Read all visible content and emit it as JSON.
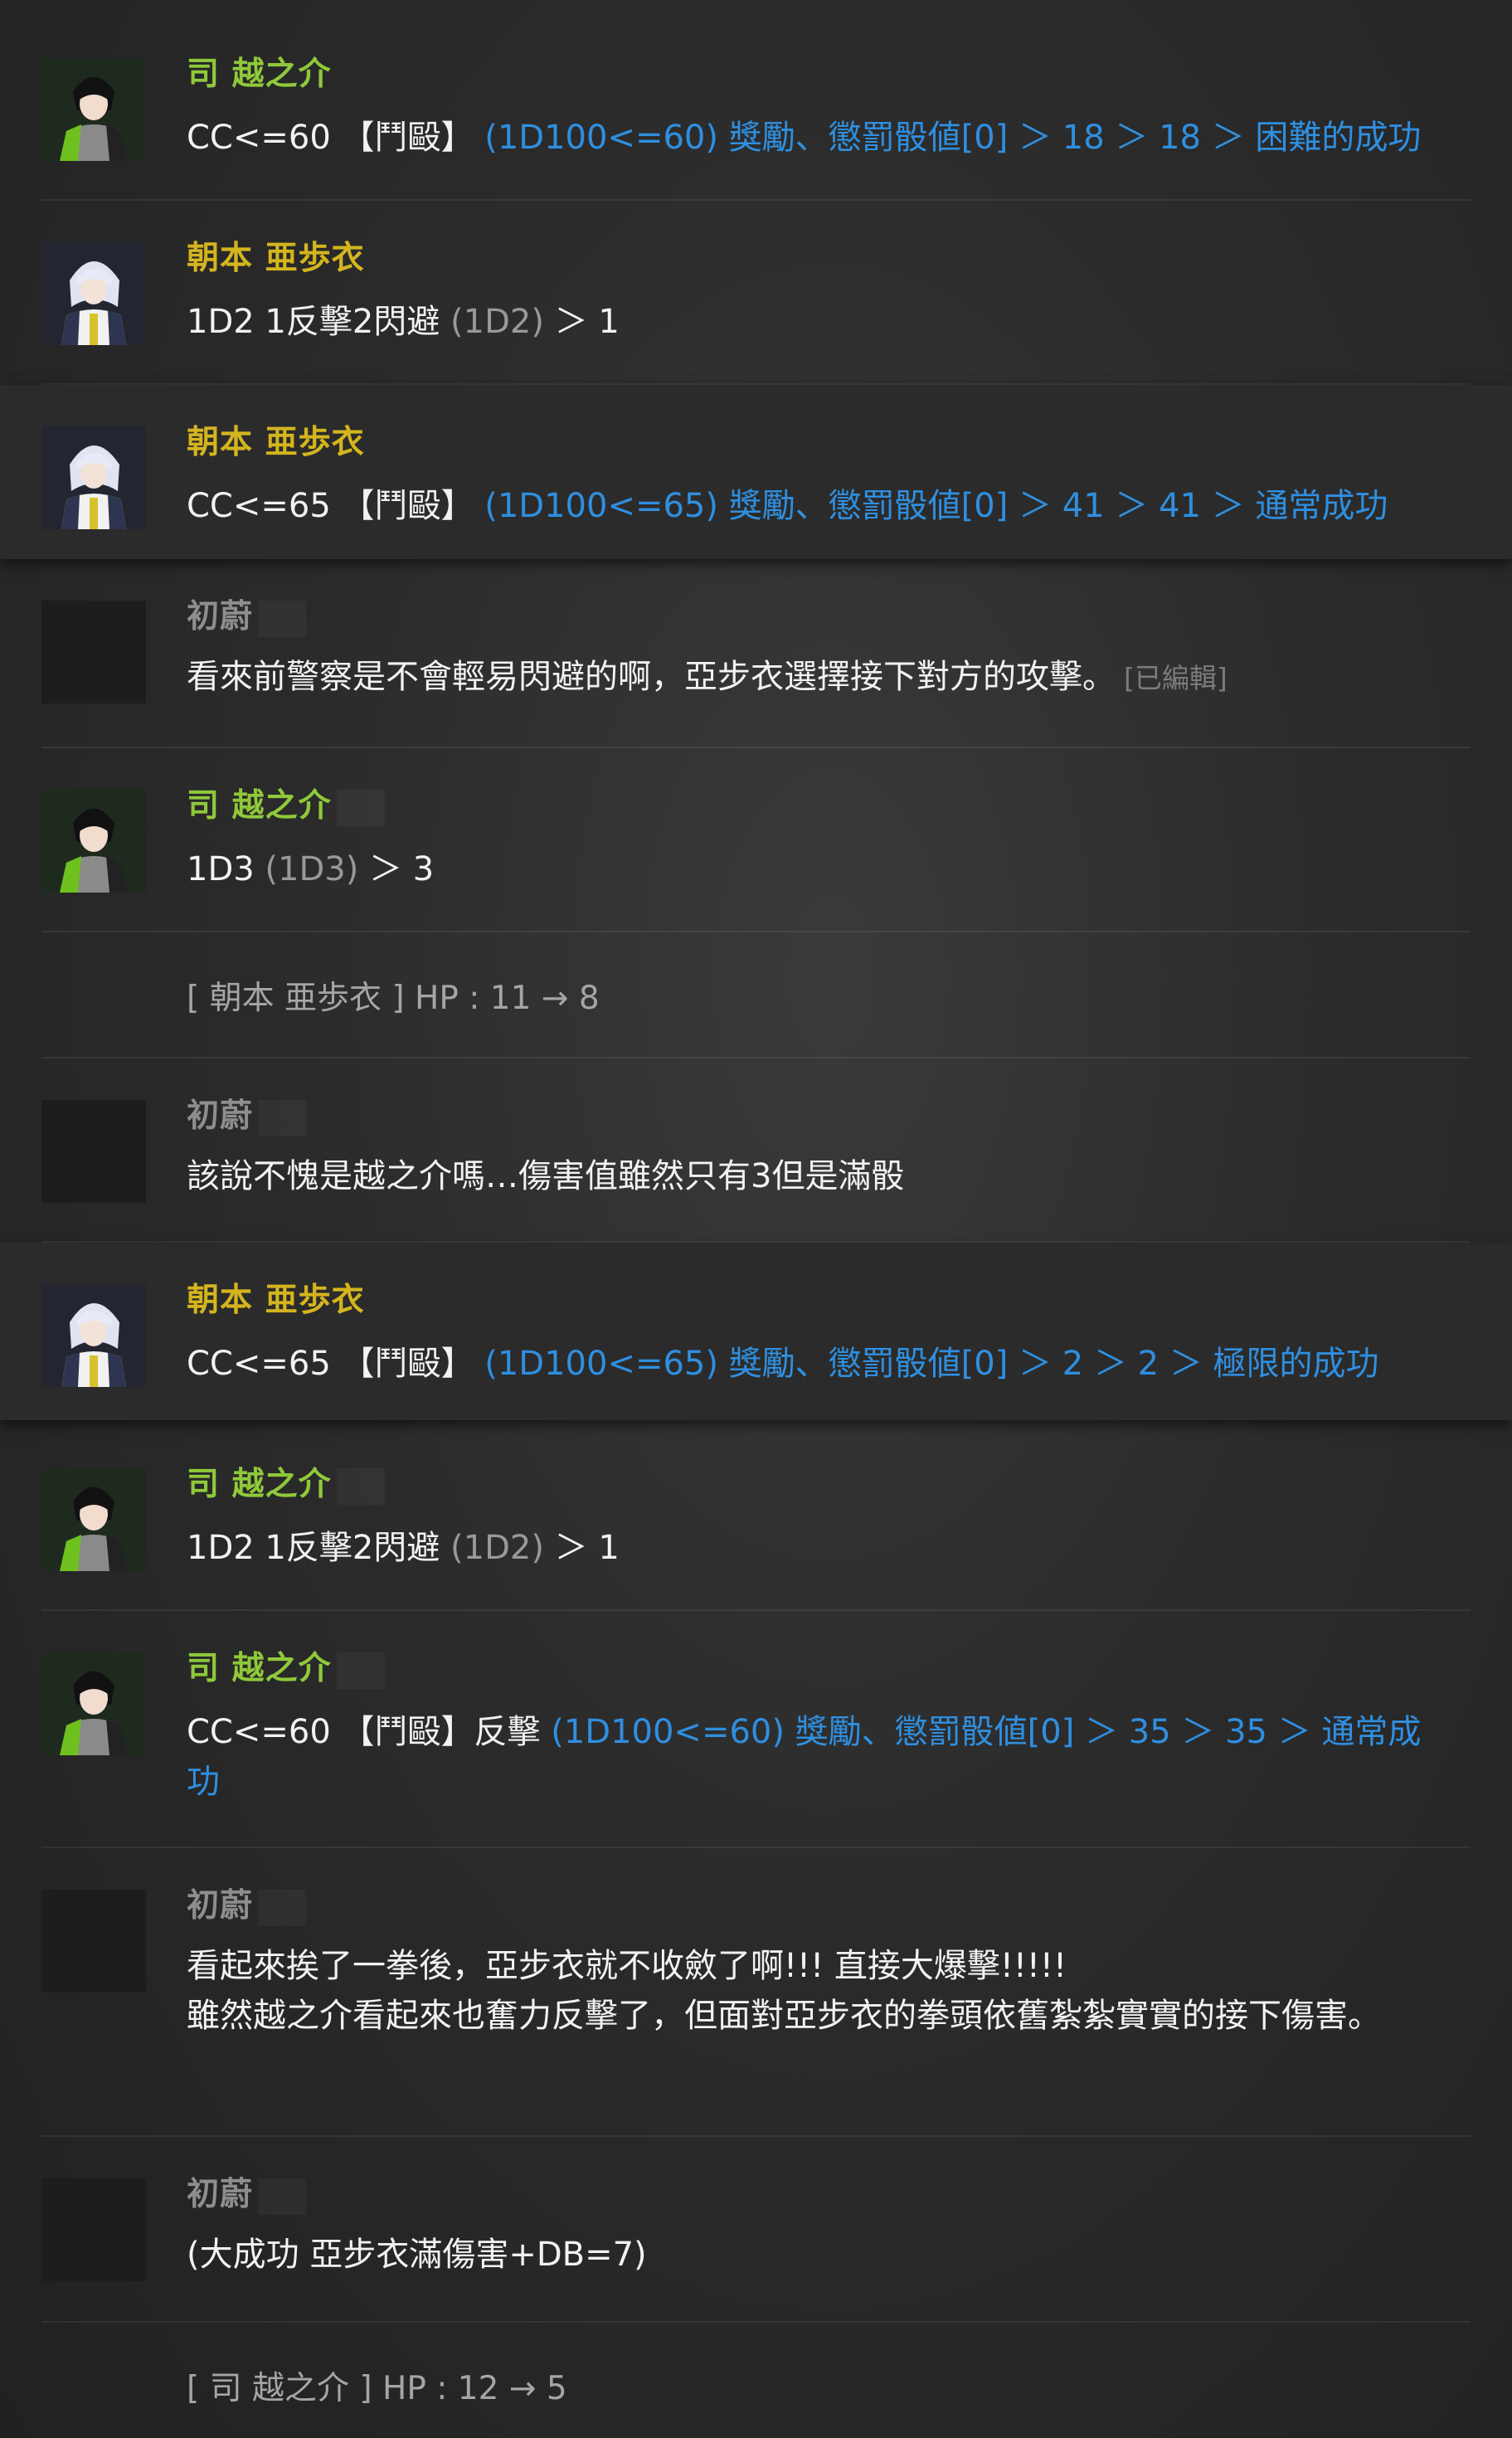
{
  "messages": [
    {
      "type": "chat",
      "char": "tsukasa",
      "name": "司 越之介",
      "name_color": "#8fc93a",
      "text": "CC<=60 【鬥毆】",
      "dice": "",
      "result": "(1D100<=60) 獎勵、懲罰骰値[0] ＞ 18 ＞ 18 ＞ 困難的成功",
      "elevated": false
    },
    {
      "type": "chat",
      "char": "asamoto",
      "name": "朝本 亜歩衣",
      "name_color": "#d4b51e",
      "text": "1D2 1反擊2閃避 ",
      "dice": "(1D2)",
      "result": " ＞ 1",
      "result_plain": true,
      "elevated": false
    },
    {
      "type": "chat",
      "char": "asamoto",
      "name": "朝本 亜歩衣",
      "name_color": "#d4b51e",
      "text": "CC<=65 【鬥毆】",
      "dice": "",
      "result": "(1D100<=65) 獎勵、懲罰骰値[0] ＞ 41 ＞ 41 ＞ 通常成功",
      "elevated": true
    },
    {
      "type": "chat",
      "char": "gm",
      "name": "初蔚",
      "name_color": "#8e8e8e",
      "text": "看來前警察是不會輕易閃避的啊，亞步衣選擇接下對方的攻擊。",
      "edited": "[已編輯]",
      "elevated": false
    },
    {
      "type": "chat",
      "char": "tsukasa",
      "name": "司 越之介",
      "name_color": "#8fc93a",
      "text": "1D3 ",
      "dice": "(1D3)",
      "result": " ＞ 3",
      "result_plain": true,
      "elevated": false
    },
    {
      "type": "system",
      "text": "[ 朝本 亜歩衣 ] HP : 11 → 8"
    },
    {
      "type": "chat",
      "char": "gm",
      "name": "初蔚",
      "name_color": "#8e8e8e",
      "text": "該說不愧是越之介嗎…傷害值雖然只有3但是滿骰",
      "elevated": false
    },
    {
      "type": "chat",
      "char": "asamoto",
      "name": "朝本 亜歩衣",
      "name_color": "#d4b51e",
      "text": "CC<=65 【鬥毆】",
      "dice": "",
      "result": "(1D100<=65) 獎勵、懲罰骰値[0] ＞ 2 ＞ 2 ＞ 極限的成功",
      "elevated": true
    },
    {
      "type": "chat",
      "char": "tsukasa",
      "name": "司 越之介",
      "name_color": "#8fc93a",
      "text": "1D2 1反擊2閃避 ",
      "dice": "(1D2)",
      "result": " ＞ 1",
      "result_plain": true,
      "elevated": false
    },
    {
      "type": "chat",
      "char": "tsukasa",
      "name": "司 越之介",
      "name_color": "#8fc93a",
      "text": "CC<=60 【鬥毆】反擊 ",
      "dice": "",
      "result": "(1D100<=60) 獎勵、懲罰骰値[0] ＞ 35 ＞ 35 ＞ 通常成功",
      "elevated": false
    },
    {
      "type": "chat",
      "char": "gm",
      "name": "初蔚",
      "name_color": "#8e8e8e",
      "text": "看起來挨了一拳後，亞步衣就不收斂了啊!!! 直接大爆擊!!!!!\n雖然越之介看起來也奮力反擊了，但面對亞步衣的拳頭依舊紮紮實實的接下傷害。",
      "elevated": false
    },
    {
      "type": "chat",
      "char": "gm",
      "name": "初蔚",
      "name_color": "#8e8e8e",
      "text": "(大成功 亞步衣滿傷害+DB=7)",
      "elevated": false
    },
    {
      "type": "system",
      "text": "[ 司 越之介 ] HP : 12 → 5"
    }
  ]
}
